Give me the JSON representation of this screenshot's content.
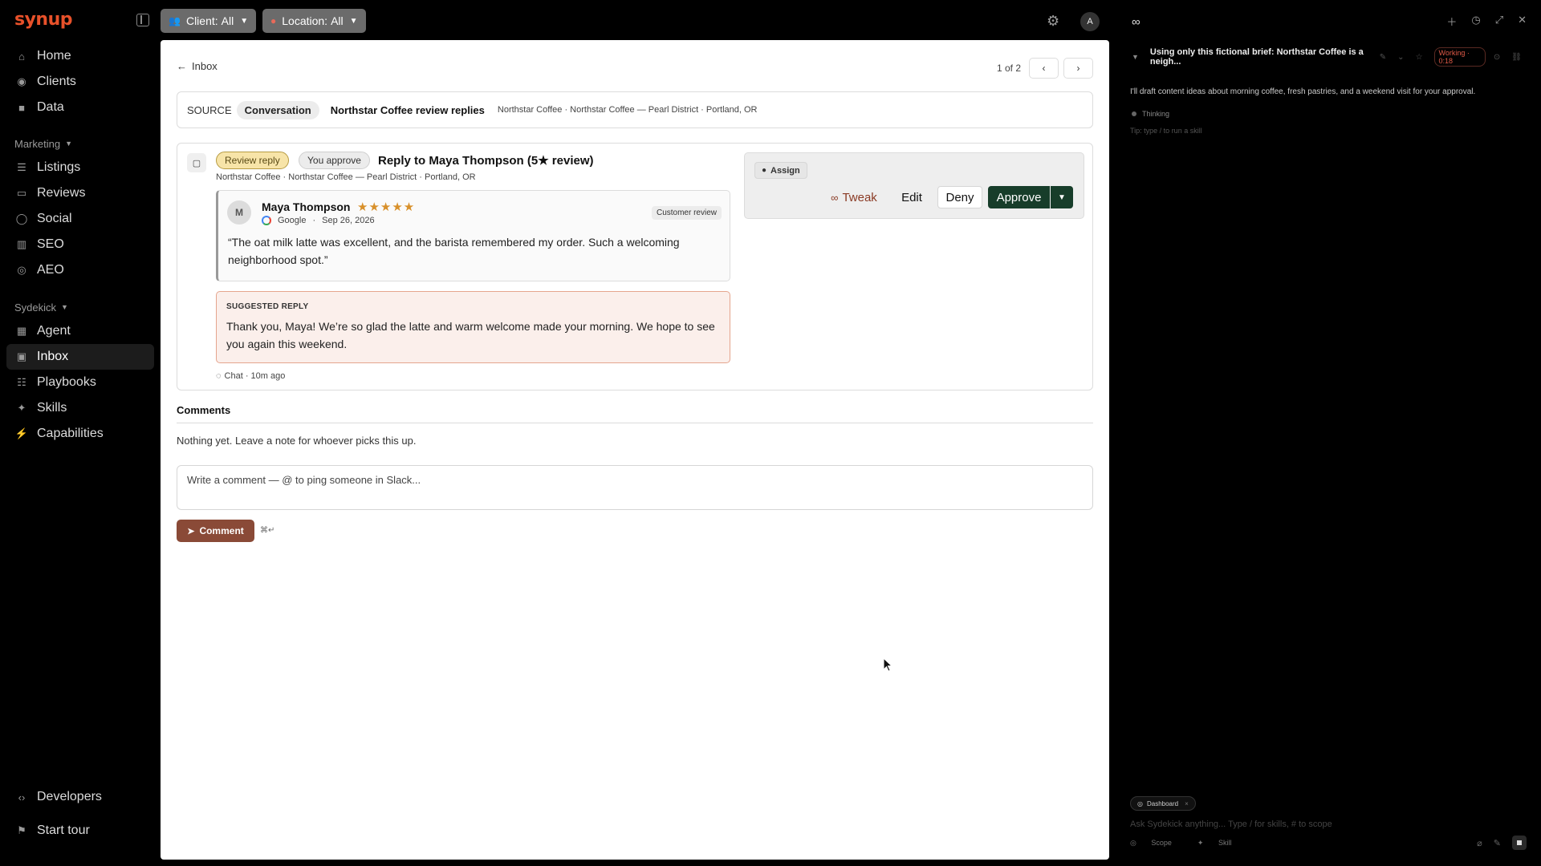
{
  "brand": {
    "logo": "synup"
  },
  "topbar": {
    "client_label": "Client:",
    "client_value": "All",
    "location_label": "Location:",
    "location_value": "All",
    "avatar": "A"
  },
  "sidebar": {
    "primary": [
      {
        "label": "Home",
        "icon": "home-icon"
      },
      {
        "label": "Clients",
        "icon": "users-icon"
      },
      {
        "label": "Data",
        "icon": "folder-icon"
      }
    ],
    "marketing_label": "Marketing",
    "marketing": [
      {
        "label": "Listings",
        "icon": "list-icon"
      },
      {
        "label": "Reviews",
        "icon": "chat-icon"
      },
      {
        "label": "Social",
        "icon": "share-icon"
      },
      {
        "label": "SEO",
        "icon": "chart-icon"
      },
      {
        "label": "AEO",
        "icon": "target-icon"
      }
    ],
    "sydekick_label": "Sydekick",
    "sydekick": [
      {
        "label": "Agent",
        "icon": "grid-icon"
      },
      {
        "label": "Inbox",
        "icon": "inbox-icon",
        "active": true
      },
      {
        "label": "Playbooks",
        "icon": "playbook-icon"
      },
      {
        "label": "Skills",
        "icon": "sparkle-icon"
      },
      {
        "label": "Capabilities",
        "icon": "plug-icon"
      }
    ],
    "footer": [
      {
        "label": "Developers",
        "icon": "code-icon"
      },
      {
        "label": "Start tour",
        "icon": "tour-icon"
      }
    ]
  },
  "detail": {
    "back_label": "Inbox",
    "pager": "1 of 2",
    "source": {
      "label": "SOURCE",
      "pill": "Conversation",
      "title": "Northstar Coffee review replies",
      "meta": "Northstar Coffee · Northstar Coffee — Pearl District · Portland, OR"
    },
    "card": {
      "tag_type": "Review reply",
      "tag_status": "You approve",
      "title": "Reply to Maya Thompson (5★ review)",
      "subtitle": "Northstar Coffee · Northstar Coffee — Pearl District · Portland, OR",
      "review": {
        "avatar": "M",
        "name": "Maya Thompson",
        "rating": 5,
        "stars": "★★★★★",
        "platform": "Google",
        "date": "Sep 26, 2026",
        "badge": "Customer review",
        "text": "“The oat milk latte was excellent, and the barista remembered my order. Such a welcoming neighborhood spot.”"
      },
      "suggested": {
        "label": "SUGGESTED REPLY",
        "text": "Thank you, Maya! We’re so glad the latte and warm welcome made your morning. We hope to see you again this weekend."
      },
      "chat_meta": "Chat · 10m ago",
      "actions": {
        "assign": "Assign",
        "tweak": "Tweak",
        "edit": "Edit",
        "deny": "Deny",
        "approve": "Approve"
      }
    },
    "comments": {
      "title": "Comments",
      "empty": "Nothing yet. Leave a note for whoever picks this up.",
      "placeholder": "Write a comment — @ to ping someone in Slack...",
      "button": "Comment",
      "shortcut": "⌘↵"
    }
  },
  "assistant": {
    "thread_title": "Using only this fictional brief: Northstar Coffee is a neigh...",
    "status": "Working · 0:18",
    "message": "I'll draft content ideas about morning coffee, fresh pastries, and a weekend visit for your approval.",
    "thinking": "Thinking",
    "tip": "Tip: type / to run a skill",
    "chip": "Dashboard",
    "placeholder": "Ask Sydekick anything... Type / for skills, # to scope",
    "scope": "Scope",
    "skill": "Skill"
  },
  "colors": {
    "brand": "#e8512a",
    "approve": "#173d2a",
    "comment_button": "#8a4a37",
    "stars": "#d8902a",
    "working": "#e05a47"
  }
}
